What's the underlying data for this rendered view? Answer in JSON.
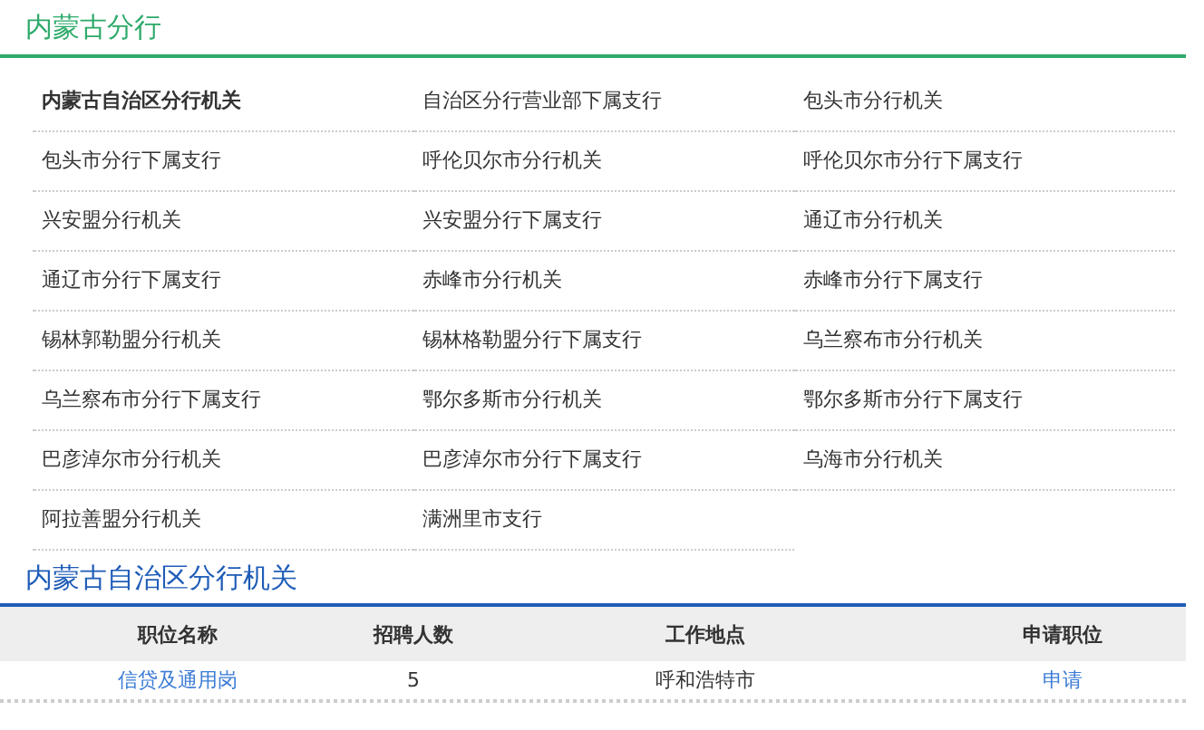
{
  "heading": "内蒙古分行",
  "branches": [
    {
      "label": "内蒙古自治区分行机关",
      "selected": true
    },
    {
      "label": "自治区分行营业部下属支行",
      "selected": false
    },
    {
      "label": "包头市分行机关",
      "selected": false
    },
    {
      "label": "包头市分行下属支行",
      "selected": false
    },
    {
      "label": "呼伦贝尔市分行机关",
      "selected": false
    },
    {
      "label": "呼伦贝尔市分行下属支行",
      "selected": false
    },
    {
      "label": "兴安盟分行机关",
      "selected": false
    },
    {
      "label": "兴安盟分行下属支行",
      "selected": false
    },
    {
      "label": "通辽市分行机关",
      "selected": false
    },
    {
      "label": "通辽市分行下属支行",
      "selected": false
    },
    {
      "label": "赤峰市分行机关",
      "selected": false
    },
    {
      "label": "赤峰市分行下属支行",
      "selected": false
    },
    {
      "label": "锡林郭勒盟分行机关",
      "selected": false
    },
    {
      "label": "锡林格勒盟分行下属支行",
      "selected": false
    },
    {
      "label": "乌兰察布市分行机关",
      "selected": false
    },
    {
      "label": "乌兰察布市分行下属支行",
      "selected": false
    },
    {
      "label": "鄂尔多斯市分行机关",
      "selected": false
    },
    {
      "label": "鄂尔多斯市分行下属支行",
      "selected": false
    },
    {
      "label": "巴彦淖尔市分行机关",
      "selected": false
    },
    {
      "label": "巴彦淖尔市分行下属支行",
      "selected": false
    },
    {
      "label": "乌海市分行机关",
      "selected": false
    },
    {
      "label": "阿拉善盟分行机关",
      "selected": false
    },
    {
      "label": "满洲里市支行",
      "selected": false
    }
  ],
  "section": {
    "title": "内蒙古自治区分行机关",
    "table": {
      "columns": [
        "职位名称",
        "招聘人数",
        "工作地点",
        "申请职位"
      ],
      "rows": [
        {
          "position": "信贷及通用岗",
          "count": "5",
          "location": "呼和浩特市",
          "apply": "申请"
        }
      ]
    }
  }
}
